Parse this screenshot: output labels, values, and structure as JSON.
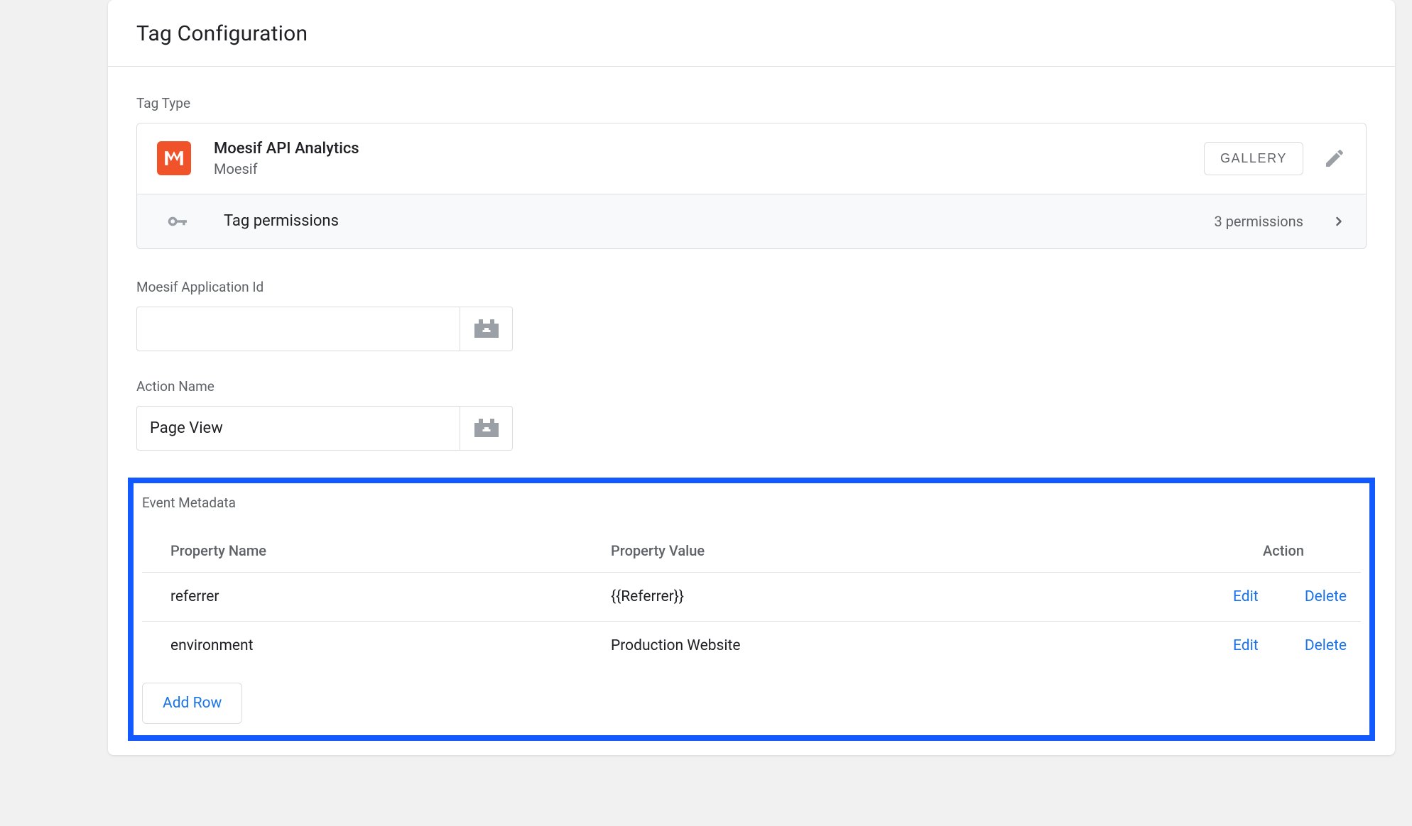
{
  "header": {
    "title": "Tag Configuration"
  },
  "tag_type": {
    "label": "Tag Type",
    "name": "Moesif API Analytics",
    "vendor": "Moesif",
    "gallery_label": "GALLERY"
  },
  "permissions": {
    "label": "Tag permissions",
    "count_text": "3 permissions"
  },
  "fields": {
    "app_id": {
      "label": "Moesif Application Id",
      "value": ""
    },
    "action_name": {
      "label": "Action Name",
      "value": "Page View"
    }
  },
  "metadata": {
    "label": "Event Metadata",
    "columns": {
      "name": "Property Name",
      "value": "Property Value",
      "action": "Action"
    },
    "rows": [
      {
        "name": "referrer",
        "value": "{{Referrer}}"
      },
      {
        "name": "environment",
        "value": "Production Website"
      }
    ],
    "actions": {
      "edit": "Edit",
      "delete": "Delete"
    },
    "add_row": "Add Row"
  }
}
